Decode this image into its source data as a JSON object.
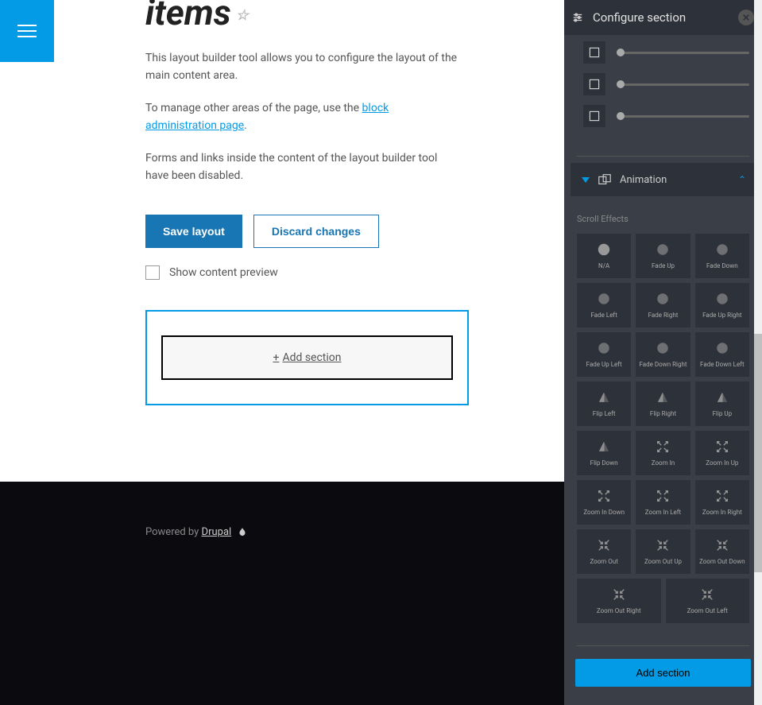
{
  "page": {
    "title": "items"
  },
  "description": {
    "p1a": "This layout builder tool allows you to configure the layout of the main content area.",
    "p2_pre": "To manage other areas of the page, use the ",
    "p2_link": "block administration page",
    "p3": "Forms and links inside the content of the layout builder tool have been disabled."
  },
  "buttons": {
    "save": "Save layout",
    "discard": "Discard changes"
  },
  "checkbox": {
    "label": "Show content preview"
  },
  "add_section": {
    "label": "Add section"
  },
  "footer": {
    "powered_by": "Powered by ",
    "drupal": "Drupal"
  },
  "sidebar": {
    "title": "Configure section",
    "accordion": {
      "animation": "Animation"
    },
    "scroll_effects_label": "Scroll Effects",
    "effects": [
      "N/A",
      "Fade Up",
      "Fade Down",
      "Fade Left",
      "Fade Right",
      "Fade Up Right",
      "Fade Up Left",
      "Fade Down Right",
      "Fade Down Left",
      "Flip Left",
      "Flip Right",
      "Flip Up",
      "Flip Down",
      "Zoom In",
      "Zoom In Up",
      "Zoom In Down",
      "Zoom In Left",
      "Zoom In Right",
      "Zoom Out",
      "Zoom Out Up",
      "Zoom Out Down"
    ],
    "effects2": [
      "Zoom Out Right",
      "Zoom Out Left"
    ],
    "add_section_btn": "Add section"
  }
}
